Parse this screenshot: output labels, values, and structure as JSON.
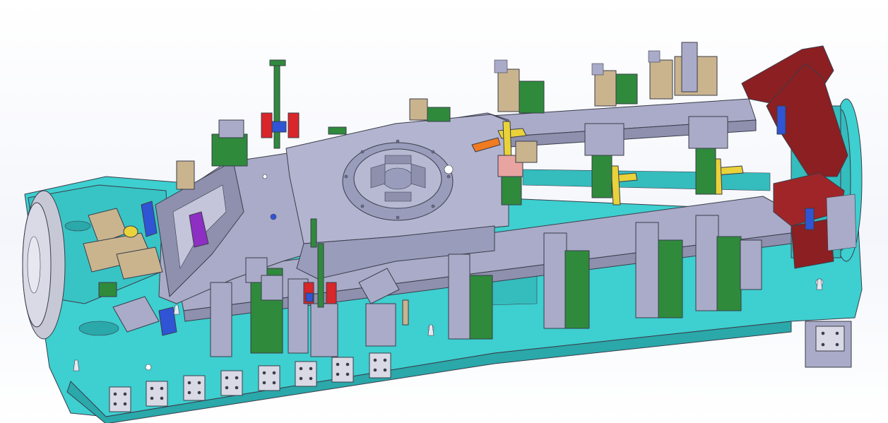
{
  "colors": {
    "base": "#3ecfd0",
    "base_dark": "#2aa8aa",
    "frame": "#a9abc8",
    "frame_dark": "#8e90ae",
    "clamp_green": "#2f8a3c",
    "block_tan": "#c9b48e",
    "fixture_red": "#8b1f22",
    "accent_yellow": "#e9d23a",
    "accent_blue": "#2f55d4",
    "accent_purple": "#8e2fc4",
    "accent_orange": "#f07b20",
    "line": "#3a3d4a"
  }
}
